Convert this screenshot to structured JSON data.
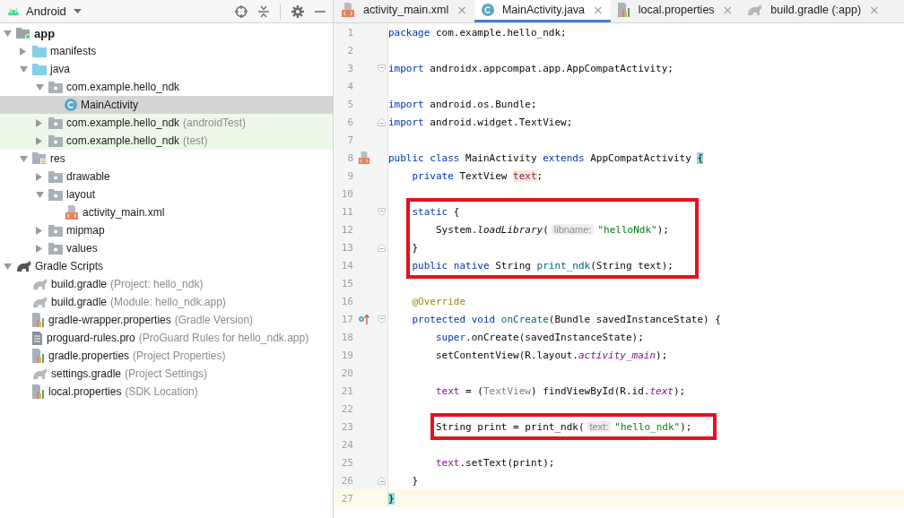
{
  "project_panel": {
    "view": "Android"
  },
  "project_tree": {
    "items": [
      {
        "label": "app",
        "kind": "module",
        "bold": true,
        "expanded": true,
        "selected": false,
        "test": false,
        "children": [
          {
            "label": "manifests",
            "kind": "folder_blue",
            "expanded": false,
            "selected": false,
            "test": false
          },
          {
            "label": "java",
            "kind": "folder_blue",
            "expanded": true,
            "selected": false,
            "test": false,
            "children": [
              {
                "label": "com.example.hello_ndk",
                "kind": "package",
                "expanded": true,
                "selected": false,
                "test": false,
                "children": [
                  {
                    "label": "MainActivity",
                    "kind": "class",
                    "selected": true,
                    "test": false
                  }
                ]
              },
              {
                "label": "com.example.hello_ndk",
                "note": "(androidTest)",
                "kind": "package",
                "expanded": false,
                "selected": false,
                "test": true
              },
              {
                "label": "com.example.hello_ndk",
                "note": "(test)",
                "kind": "package",
                "expanded": false,
                "selected": false,
                "test": true
              }
            ]
          },
          {
            "label": "res",
            "kind": "res",
            "expanded": true,
            "selected": false,
            "test": false,
            "children": [
              {
                "label": "drawable",
                "kind": "package",
                "expanded": false,
                "selected": false,
                "test": false
              },
              {
                "label": "layout",
                "kind": "package",
                "expanded": true,
                "selected": false,
                "test": false,
                "children": [
                  {
                    "label": "activity_main.xml",
                    "kind": "xml",
                    "selected": false,
                    "test": false
                  }
                ]
              },
              {
                "label": "mipmap",
                "kind": "package",
                "expanded": false,
                "selected": false,
                "test": false
              },
              {
                "label": "values",
                "kind": "package",
                "expanded": false,
                "selected": false,
                "test": false
              }
            ]
          }
        ]
      },
      {
        "label": "Gradle Scripts",
        "kind": "gradle_dark",
        "expanded": true,
        "selected": false,
        "test": false,
        "children": [
          {
            "label": "build.gradle",
            "note": "(Project: hello_ndk)",
            "kind": "gradle",
            "selected": false,
            "test": false
          },
          {
            "label": "build.gradle",
            "note": "(Module: hello_ndk.app)",
            "kind": "gradle",
            "selected": false,
            "test": false
          },
          {
            "label": "gradle-wrapper.properties",
            "note": "(Gradle Version)",
            "kind": "properties",
            "selected": false,
            "test": false
          },
          {
            "label": "proguard-rules.pro",
            "note": "(ProGuard Rules for hello_ndk.app)",
            "kind": "text",
            "selected": false,
            "test": false
          },
          {
            "label": "gradle.properties",
            "note": "(Project Properties)",
            "kind": "properties",
            "selected": false,
            "test": false
          },
          {
            "label": "settings.gradle",
            "note": "(Project Settings)",
            "kind": "gradle",
            "selected": false,
            "test": false
          },
          {
            "label": "local.properties",
            "note": "(SDK Location)",
            "kind": "properties",
            "selected": false,
            "test": false
          }
        ]
      }
    ]
  },
  "tabs": [
    {
      "label": "activity_main.xml",
      "kind": "xml",
      "close": "×",
      "selected": false
    },
    {
      "label": "MainActivity.java",
      "kind": "class",
      "close": "×",
      "selected": true
    },
    {
      "label": "local.properties",
      "kind": "properties",
      "close": "×",
      "selected": false
    },
    {
      "label": "build.gradle (:app)",
      "kind": "gradle",
      "close": "×",
      "selected": false
    }
  ],
  "editor": {
    "blocks": [
      {
        "boxed": false,
        "lines": [
          {
            "number": "1",
            "current": false,
            "tokens": [
              {
                "kind": "keyword",
                "text": "package"
              },
              {
                "kind": "plain",
                "text": " com.example.hello_ndk;"
              }
            ]
          },
          {
            "number": "2",
            "current": false
          },
          {
            "number": "3",
            "current": false,
            "fold_start": true,
            "tokens": [
              {
                "kind": "keyword",
                "text": "import"
              },
              {
                "kind": "plain",
                "text": " androidx.appcompat.app.AppCompatActivity;"
              }
            ]
          },
          {
            "number": "4",
            "current": false
          },
          {
            "number": "5",
            "current": false,
            "tokens": [
              {
                "kind": "keyword",
                "text": "import"
              },
              {
                "kind": "plain",
                "text": " android.os.Bundle;"
              }
            ]
          },
          {
            "number": "6",
            "current": false,
            "fold_end": true,
            "tokens": [
              {
                "kind": "keyword",
                "text": "import"
              },
              {
                "kind": "plain",
                "text": " android.widget.TextView;"
              }
            ]
          },
          {
            "number": "7",
            "current": false
          },
          {
            "number": "8",
            "current": false,
            "xml_marker": true,
            "tokens": [
              {
                "kind": "keyword",
                "text": "public class"
              },
              {
                "kind": "plain",
                "text": " MainActivity "
              },
              {
                "kind": "keyword",
                "text": "extends"
              },
              {
                "kind": "plain",
                "text": " AppCompatActivity "
              },
              {
                "kind": "brace_match",
                "text": "{"
              }
            ]
          },
          {
            "number": "9",
            "current": false,
            "tokens": [
              {
                "kind": "keyword",
                "text": "    private"
              },
              {
                "kind": "plain",
                "text": " TextView "
              },
              {
                "kind": "field_usage",
                "text": "text"
              },
              {
                "kind": "plain",
                "text": ";"
              }
            ]
          },
          {
            "number": "10",
            "current": false
          }
        ]
      },
      {
        "boxed": true,
        "lines": [
          {
            "number": "11",
            "current": false,
            "fold_start": true,
            "tokens": [
              {
                "kind": "keyword",
                "text": "    static"
              },
              {
                "kind": "plain",
                "text": " {"
              }
            ]
          },
          {
            "number": "12",
            "current": false,
            "tokens": [
              {
                "kind": "plain",
                "text": "        System."
              },
              {
                "kind": "static_call",
                "text": "loadLibrary"
              },
              {
                "kind": "plain",
                "text": "("
              },
              {
                "kind": "hint",
                "text": "libname:"
              },
              {
                "kind": "string",
                "text": "\"helloNdk\""
              },
              {
                "kind": "plain",
                "text": ");"
              }
            ]
          },
          {
            "number": "13",
            "current": false,
            "fold_end": true,
            "tokens": [
              {
                "kind": "plain",
                "text": "    }"
              }
            ]
          },
          {
            "number": "14",
            "current": false,
            "tokens": [
              {
                "kind": "keyword",
                "text": "    public native"
              },
              {
                "kind": "plain",
                "text": " String "
              },
              {
                "kind": "declaration",
                "text": "print_ndk"
              },
              {
                "kind": "plain",
                "text": "(String text);"
              }
            ]
          }
        ]
      },
      {
        "boxed": false,
        "lines": [
          {
            "number": "15",
            "current": false
          },
          {
            "number": "16",
            "current": false,
            "tokens": [
              {
                "kind": "annotation",
                "text": "    @Override"
              }
            ]
          },
          {
            "number": "17",
            "current": false,
            "fold_start": true,
            "override_marker": true,
            "tokens": [
              {
                "kind": "keyword",
                "text": "    protected void "
              },
              {
                "kind": "declaration",
                "text": "onCreate"
              },
              {
                "kind": "plain",
                "text": "(Bundle savedInstanceState) {"
              }
            ]
          },
          {
            "number": "18",
            "current": false,
            "tokens": [
              {
                "kind": "keyword",
                "text": "        super"
              },
              {
                "kind": "plain",
                "text": ".onCreate(savedInstanceState);"
              }
            ]
          },
          {
            "number": "19",
            "current": false,
            "tokens": [
              {
                "kind": "plain",
                "text": "        setContentView(R.layout."
              },
              {
                "kind": "static_field",
                "text": "activity_main"
              },
              {
                "kind": "plain",
                "text": ");"
              }
            ]
          },
          {
            "number": "20",
            "current": false
          },
          {
            "number": "21",
            "current": false,
            "tokens": [
              {
                "kind": "field",
                "text": "        text"
              },
              {
                "kind": "plain",
                "text": " = ("
              },
              {
                "kind": "grey",
                "text": "TextView"
              },
              {
                "kind": "plain",
                "text": ") findViewById(R.id."
              },
              {
                "kind": "static_field",
                "text": "text"
              },
              {
                "kind": "plain",
                "text": ");"
              }
            ]
          },
          {
            "number": "22",
            "current": false
          }
        ]
      },
      {
        "boxed": true,
        "lines": [
          {
            "number": "23",
            "current": false,
            "tokens": [
              {
                "kind": "plain",
                "text": "        String print = print_ndk("
              },
              {
                "kind": "hint",
                "text": "text:"
              },
              {
                "kind": "string",
                "text": "\"hello_ndk\""
              },
              {
                "kind": "plain",
                "text": ");"
              }
            ]
          }
        ]
      },
      {
        "boxed": false,
        "lines": [
          {
            "number": "24",
            "current": false
          },
          {
            "number": "25",
            "current": false,
            "tokens": [
              {
                "kind": "field",
                "text": "        text"
              },
              {
                "kind": "plain",
                "text": ".setText(print);"
              }
            ]
          },
          {
            "number": "26",
            "current": false,
            "fold_end": true,
            "tokens": [
              {
                "kind": "plain",
                "text": "    }"
              }
            ]
          },
          {
            "number": "27",
            "current": true,
            "tokens": [
              {
                "kind": "brace_match",
                "text": "}"
              }
            ]
          }
        ]
      }
    ]
  }
}
